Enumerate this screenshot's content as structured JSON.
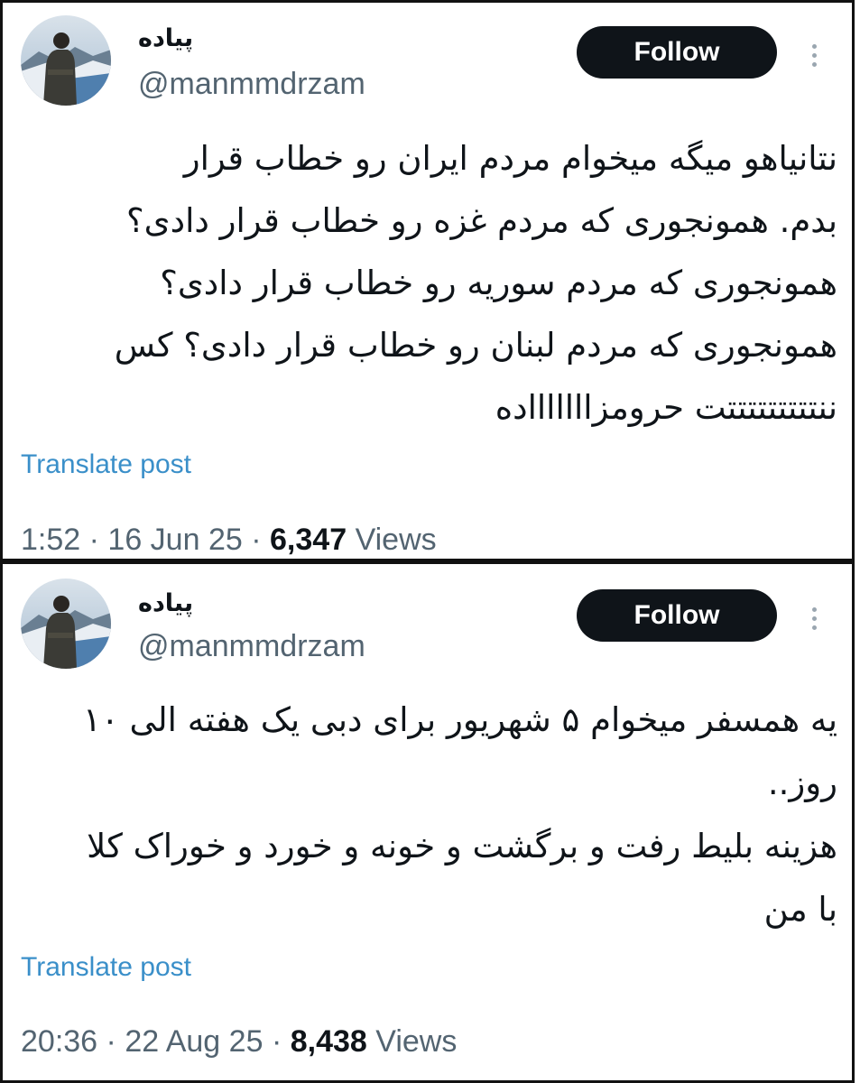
{
  "tweets": [
    {
      "display_name": "پیاده",
      "handle": "@manmmdrzam",
      "follow_label": "Follow",
      "text_lines": [
        "نتانیاهو میگه میخوام مردم ایران رو خطاب قرار",
        "بدم. همونجوری که مردم غزه رو خطاب قرار دادی؟",
        "همونجوری که مردم سوریه رو خطاب قرار دادی؟",
        "همونجوری که مردم لبنان رو خطاب قرار دادی؟ کس",
        "ننتتتتتتتتتت حرومزاااااااده"
      ],
      "translate_label": "Translate post",
      "time": "1:52",
      "date": "16 Jun 25",
      "views_count": "6,347",
      "views_label": "Views",
      "separator": "·"
    },
    {
      "display_name": "پیاده",
      "handle": "@manmmdrzam",
      "follow_label": "Follow",
      "text_lines": [
        "یه همسفر میخوام ۵ شهریور برای دبی یک هفته الی ۱۰",
        "روز..",
        "هزینه بلیط رفت و برگشت و خونه و خورد و خوراک کلا",
        "با من"
      ],
      "translate_label": "Translate post",
      "time": "20:36",
      "date": "22 Aug 25",
      "views_count": "8,438",
      "views_label": "Views",
      "separator": "·"
    }
  ],
  "icons": {
    "more": "more-vertical-icon",
    "avatar": "profile-photo-person-snowy-mountains"
  },
  "colors": {
    "follow_bg": "#0f1419",
    "link": "#3a8fc9",
    "secondary_text": "#536471"
  }
}
